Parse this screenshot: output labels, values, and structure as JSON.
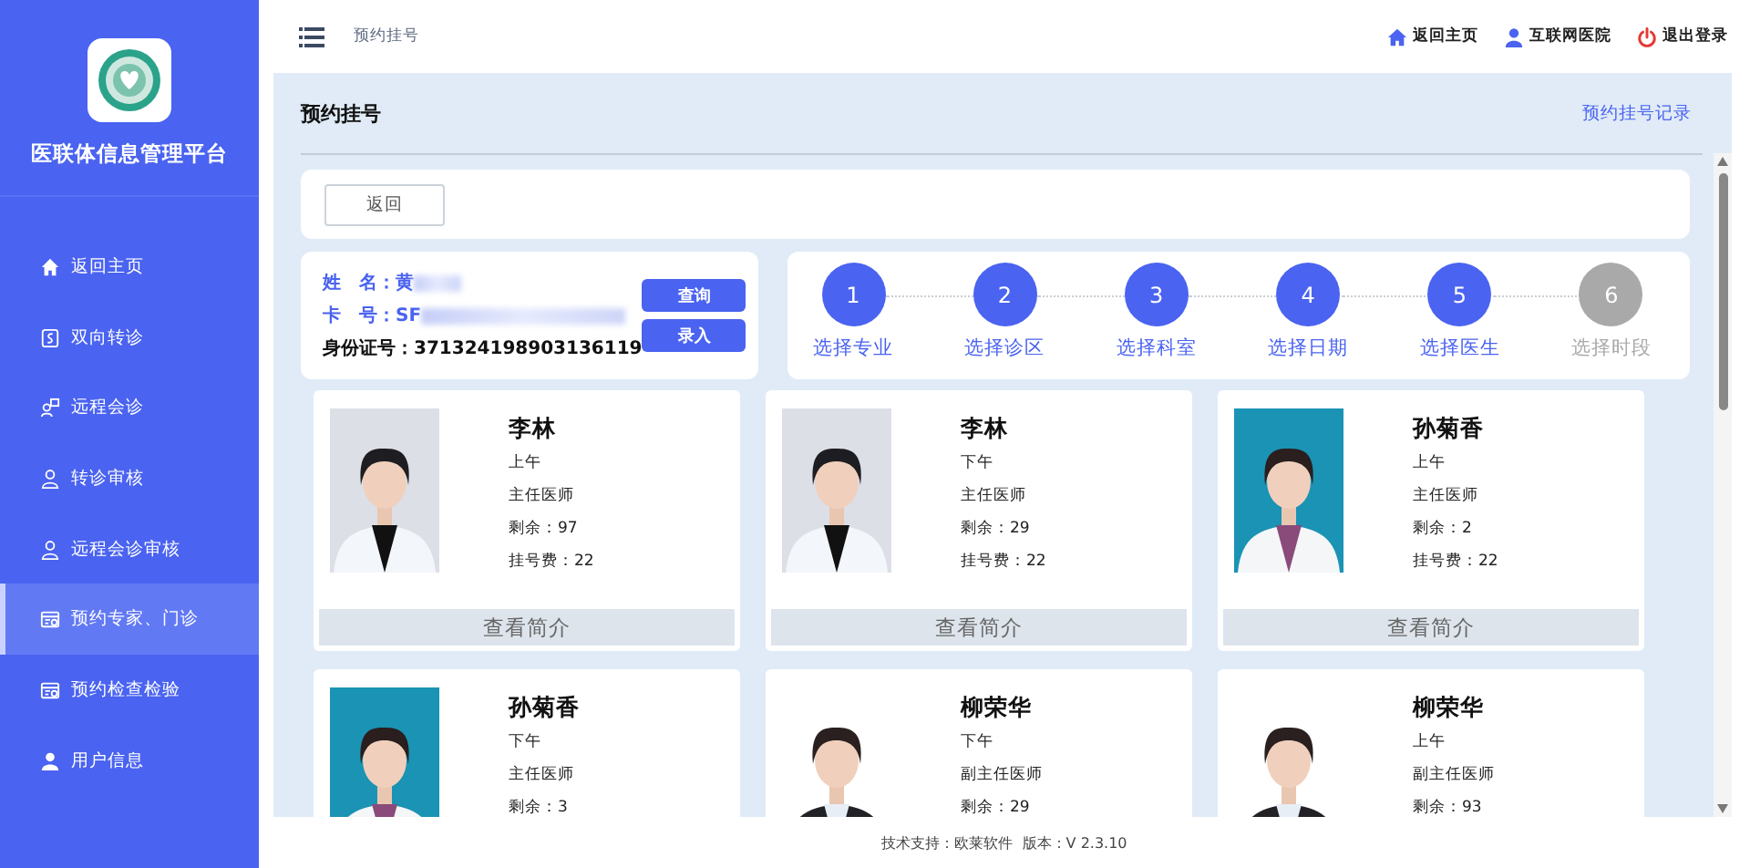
{
  "app": {
    "title": "医联体信息管理平台"
  },
  "sidebar": {
    "items": [
      {
        "label": "返回主页",
        "selected": false
      },
      {
        "label": "双向转诊",
        "selected": false
      },
      {
        "label": "远程会诊",
        "selected": false
      },
      {
        "label": "转诊审核",
        "selected": false
      },
      {
        "label": "远程会诊审核",
        "selected": false
      },
      {
        "label": "预约专家、门诊",
        "selected": true
      },
      {
        "label": "预约检查检验",
        "selected": false
      },
      {
        "label": "用户信息",
        "selected": false
      }
    ]
  },
  "topbar": {
    "breadcrumb": "预约挂号",
    "links": [
      "返回主页",
      "互联网医院",
      "退出登录"
    ]
  },
  "page": {
    "title": "预约挂号",
    "record_link": "预约挂号记录",
    "back_button": "返回"
  },
  "patient": {
    "name_label": "姓　名：",
    "name_value": "黄",
    "card_label": "卡　号：",
    "card_value": "SF",
    "id_label": "身份证号：",
    "id_value": "371324198903136119",
    "query_button": "查询",
    "enter_button": "录入"
  },
  "steps": [
    {
      "number": "1",
      "label": "选择专业",
      "done": true
    },
    {
      "number": "2",
      "label": "选择诊区",
      "done": true
    },
    {
      "number": "3",
      "label": "选择科室",
      "done": true
    },
    {
      "number": "4",
      "label": "选择日期",
      "done": true
    },
    {
      "number": "5",
      "label": "选择医生",
      "done": true
    },
    {
      "number": "6",
      "label": "选择时段",
      "done": false
    }
  ],
  "doctors": [
    {
      "name": "李林",
      "period": "上午",
      "title": "主任医师",
      "remaining": "剩余：97",
      "fee": "挂号费：22",
      "action": "查看简介",
      "kind": "picture"
    },
    {
      "name": "李林",
      "period": "下午",
      "title": "主任医师",
      "remaining": "剩余：29",
      "fee": "挂号费：22",
      "action": "查看简介",
      "kind": "picture"
    },
    {
      "name": "孙菊香",
      "period": "上午",
      "title": "主任医师",
      "remaining": "剩余：2",
      "fee": "挂号费：22",
      "action": "查看简介",
      "kind": "picture"
    },
    {
      "name": "孙菊香",
      "period": "下午",
      "title": "主任医师",
      "remaining": "剩余：3",
      "kind": "picture"
    },
    {
      "name": "柳荣华",
      "period": "下午",
      "title": "副主任医师",
      "remaining": "剩余：29",
      "kind": "picture"
    },
    {
      "name": "柳荣华",
      "period": "上午",
      "title": "副主任医师",
      "remaining": "剩余：93",
      "kind": "picture"
    }
  ],
  "footer": "技术支持：欧莱软件  版本：V 2.3.10"
}
